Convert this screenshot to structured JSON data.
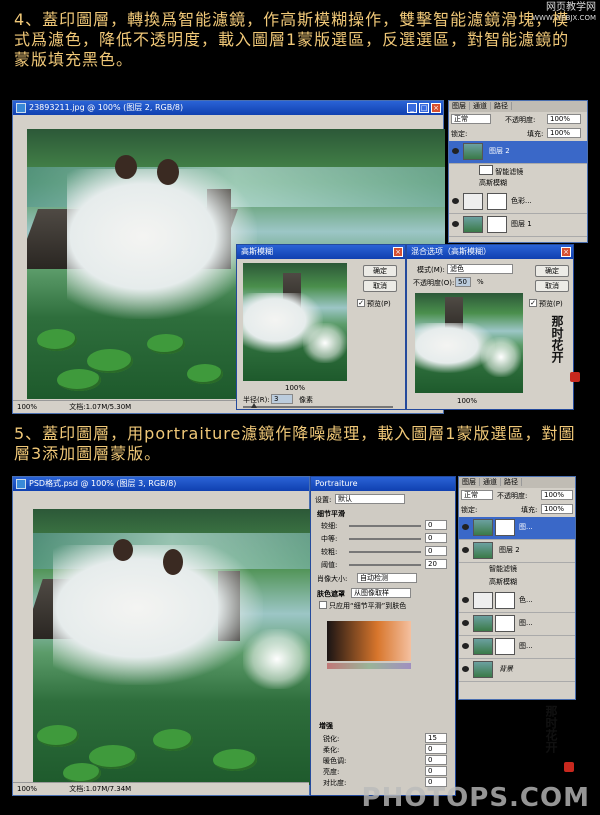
{
  "watermark_top": {
    "line1": "网页教学网",
    "line2": "WWW.WEBJX.COM"
  },
  "watermark_bottom": "PHOTOPS.COM",
  "step4": {
    "text": "4、蓋印圖層，轉換爲智能濾鏡，作高斯模糊操作，雙擊智能濾鏡滑塊，模式爲濾色，降低不透明度，載入圖層1蒙版選區，反選選區，對智能濾鏡的蒙版填充黑色。",
    "doc_title": "23893211.jpg @ 100% (图层 2, RGB/8)",
    "zoom": "100%",
    "doc_size": "文档:1.07M/5.30M",
    "gauss": {
      "title": "高斯模糊",
      "ok": "确定",
      "cancel": "取消",
      "preview": "预览(P)",
      "zoom": "100%",
      "radius_label": "半径(R):",
      "radius_value": "3",
      "unit": "像素"
    },
    "blend": {
      "title": "混合选项（高斯模糊）",
      "mode_label": "模式(M):",
      "mode_value": "滤色",
      "opacity_label": "不透明度(O):",
      "opacity_value": "50",
      "percent": "%",
      "ok": "确定",
      "cancel": "取消",
      "preview": "预览(P)",
      "zoom": "100%"
    },
    "layers": {
      "tabs": [
        "图层",
        "通道",
        "路径"
      ],
      "blend_mode": "正常",
      "opacity_label": "不透明度:",
      "opacity_value": "100%",
      "lock_label": "锁定:",
      "fill_label": "填充:",
      "fill_value": "100%",
      "rows": [
        "图层 2",
        "智能滤镜",
        "高斯模糊",
        "色彩...",
        "图层 1"
      ]
    }
  },
  "step5": {
    "text": "5、蓋印圖層，用portraiture濾鏡作降噪處理，載入圖層1蒙版選區，對圖層3添加圖層蒙版。",
    "doc_title": "PSD格式.psd @ 100% (图层 3, RGB/8)",
    "zoom": "100%",
    "doc_size": "文档:1.07M/7.34M",
    "portraiture": {
      "title": "Portraiture",
      "preset_label": "设置:",
      "preset_value": "默认",
      "section1": "细节平滑",
      "rows": [
        {
          "label": "较细:",
          "value": "0"
        },
        {
          "label": "中等:",
          "value": "0"
        },
        {
          "label": "较粗:",
          "value": "0"
        },
        {
          "label": "阈值:",
          "value": "20"
        }
      ],
      "size_label": "肖像大小:",
      "size_value": "自动检测",
      "section2": "肤色遮罩",
      "mask_preset": "从图像取样",
      "mask_check": "只应用“细节平滑”到肤色",
      "section3": "增强",
      "enh_rows": [
        {
          "label": "锐化:",
          "value": "15"
        },
        {
          "label": "柔化:",
          "value": "0"
        },
        {
          "label": "暖色调:",
          "value": "0"
        },
        {
          "label": "亮度:",
          "value": "0"
        },
        {
          "label": "对比度:",
          "value": "0"
        }
      ]
    },
    "layers": {
      "tabs": [
        "图层",
        "通道",
        "路径"
      ],
      "blend_mode": "正常",
      "opacity_label": "不透明度:",
      "opacity_value": "100%",
      "lock_label": "锁定:",
      "fill_label": "填充:",
      "fill_value": "100%",
      "rows": [
        "图...",
        "图层 2",
        "智能滤镜",
        "高斯模糊",
        "色...",
        "图...",
        "图...",
        "背景"
      ]
    }
  },
  "calligraphy": "那时花开"
}
